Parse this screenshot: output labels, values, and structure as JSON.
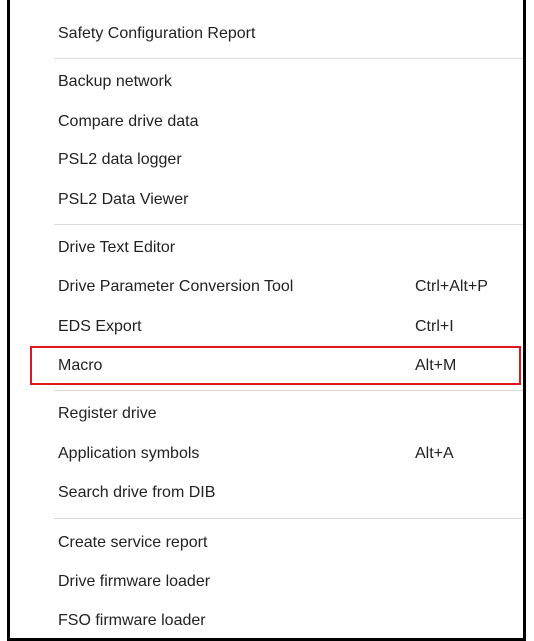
{
  "menu": {
    "items": [
      {
        "label": "Safety Configuration Report",
        "shortcut": ""
      },
      {
        "label": "Backup network",
        "shortcut": ""
      },
      {
        "label": "Compare drive data",
        "shortcut": ""
      },
      {
        "label": "PSL2 data logger",
        "shortcut": ""
      },
      {
        "label": "PSL2 Data Viewer",
        "shortcut": ""
      },
      {
        "label": "Drive Text Editor",
        "shortcut": ""
      },
      {
        "label": "Drive Parameter Conversion Tool",
        "shortcut": "Ctrl+Alt+P"
      },
      {
        "label": "EDS Export",
        "shortcut": "Ctrl+I"
      },
      {
        "label": "Macro",
        "shortcut": "Alt+M"
      },
      {
        "label": "Register drive",
        "shortcut": ""
      },
      {
        "label": "Application symbols",
        "shortcut": "Alt+A"
      },
      {
        "label": "Search drive from DIB",
        "shortcut": ""
      },
      {
        "label": "Create service report",
        "shortcut": ""
      },
      {
        "label": "Drive firmware loader",
        "shortcut": ""
      },
      {
        "label": "FSO firmware loader",
        "shortcut": ""
      }
    ]
  },
  "highlight": {
    "target": "Macro",
    "color": "#e0161e"
  }
}
